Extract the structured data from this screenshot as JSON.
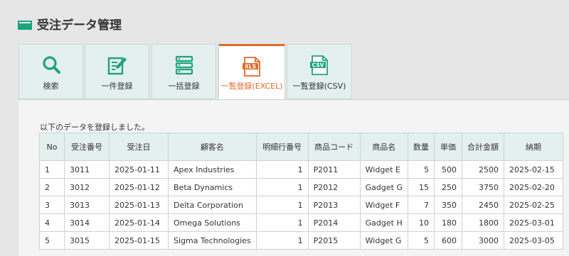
{
  "header": {
    "title": "受注データ管理",
    "icon": "window-icon",
    "accent": "#1fa37d"
  },
  "tabs": [
    {
      "label": "検索",
      "icon": "search-icon",
      "active": false
    },
    {
      "label": "一件登録",
      "icon": "edit-icon",
      "active": false
    },
    {
      "label": "一括登録",
      "icon": "list-icon",
      "active": false
    },
    {
      "label": "一覧登録(EXCEL)",
      "icon": "xls-file-icon",
      "badge": "XLS",
      "active": true
    },
    {
      "label": "一覧登録(CSV)",
      "icon": "csv-file-icon",
      "badge": "CSV",
      "active": false
    }
  ],
  "colors": {
    "tab_bg": "#e3f0ee",
    "active_accent": "#e0692a",
    "icon_green": "#1fa37d"
  },
  "message": "以下のデータを登録しました。",
  "table": {
    "headers": [
      "No",
      "受注番号",
      "受注日",
      "顧客名",
      "明細行番号",
      "商品コード",
      "商品名",
      "数量",
      "単価",
      "合計金額",
      "納期"
    ],
    "rows": [
      [
        "1",
        "3011",
        "2025-01-11",
        "Apex Industries",
        "1",
        "P2011",
        "Widget E",
        "5",
        "500",
        "2500",
        "2025-02-15"
      ],
      [
        "2",
        "3012",
        "2025-01-12",
        "Beta Dynamics",
        "1",
        "P2012",
        "Gadget G",
        "15",
        "250",
        "3750",
        "2025-02-20"
      ],
      [
        "3",
        "3013",
        "2025-01-13",
        "Delta Corporation",
        "1",
        "P2013",
        "Widget F",
        "7",
        "350",
        "2450",
        "2025-02-25"
      ],
      [
        "4",
        "3014",
        "2025-01-14",
        "Omega Solutions",
        "1",
        "P2014",
        "Gadget H",
        "10",
        "180",
        "1800",
        "2025-03-01"
      ],
      [
        "5",
        "3015",
        "2025-01-15",
        "Sigma Technologies",
        "1",
        "P2015",
        "Widget G",
        "5",
        "600",
        "3000",
        "2025-03-05"
      ]
    ]
  }
}
